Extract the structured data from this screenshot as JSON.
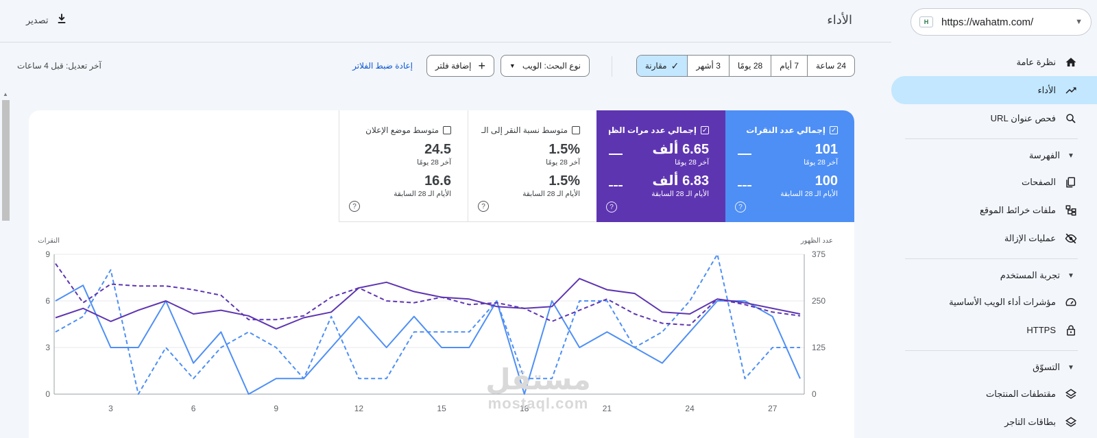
{
  "sidebar": {
    "property_url": "https://wahatm.com/",
    "property_favicon": "H",
    "nav_items": [
      {
        "label": "نظرة عامة",
        "icon": "home-icon"
      },
      {
        "label": "الأداء",
        "icon": "trending-up-icon"
      },
      {
        "label": "فحص عنوان URL",
        "icon": "search-icon"
      }
    ],
    "sections": [
      {
        "label": "الفهرسة",
        "items": [
          {
            "label": "الصفحات",
            "icon": "pages-icon"
          },
          {
            "label": "ملفات خرائط الموقع",
            "icon": "sitemap-icon"
          },
          {
            "label": "عمليات الإزالة",
            "icon": "eye-off-icon"
          }
        ]
      },
      {
        "label": "تجربة المستخدم",
        "items": [
          {
            "label": "مؤشرات أداء الويب الأساسية",
            "icon": "speedometer-icon"
          },
          {
            "label": "HTTPS",
            "icon": "lock-icon"
          }
        ]
      },
      {
        "label": "التسوّق",
        "items": [
          {
            "label": "مقتطفات المنتجات",
            "icon": "layers-icon"
          },
          {
            "label": "بطاقات التاجر",
            "icon": "layers-icon"
          }
        ]
      }
    ]
  },
  "header": {
    "title": "الأداء",
    "export_label": "تصدير"
  },
  "filters": {
    "ranges": [
      "24 ساعة",
      "7 أيام",
      "28 يومًا",
      "3 أشهر"
    ],
    "compare_label": "مقارنة",
    "search_type_label": "نوع البحث: الويب",
    "add_filter_label": "إضافة فلتر",
    "reset_label": "إعادة ضبط الفلاتر",
    "last_updated": "آخر تعديل: قبل 4 ساعات"
  },
  "metrics": [
    {
      "title": "إجمالي عدد النقرات",
      "checked": true,
      "current": "101",
      "current_label": "آخر 28 يومًا",
      "previous": "100",
      "previous_label": "الأيام الـ 28 السابقة",
      "color": "#4e8ff5"
    },
    {
      "title": "إجمالي عدد مرات الظهـ...",
      "checked": true,
      "current": "6.65 ألف",
      "current_label": "آخر 28 يومًا",
      "previous": "6.83 ألف",
      "previous_label": "الأيام الـ 28 السابقة",
      "color": "#5e35b1"
    },
    {
      "title": "متوسط نسبة النقر إلى الـ...",
      "checked": false,
      "current": "1.5%",
      "current_label": "آخر 28 يومًا",
      "previous": "1.5%",
      "previous_label": "الأيام الـ 28 السابقة"
    },
    {
      "title": "متوسط موضع الإعلان",
      "checked": false,
      "current": "24.5",
      "current_label": "آخر 28 يومًا",
      "previous": "16.6",
      "previous_label": "الأيام الـ 28 السابقة"
    }
  ],
  "chart_data": {
    "type": "line",
    "left_axis_label": "النقرات",
    "right_axis_label": "عدد الظهور",
    "left_ylim": [
      0,
      9
    ],
    "left_ticks": [
      0,
      3,
      6,
      9
    ],
    "right_ylim": [
      0,
      375
    ],
    "right_ticks": [
      0,
      125,
      250,
      375
    ],
    "x": [
      1,
      2,
      3,
      4,
      5,
      6,
      7,
      8,
      9,
      10,
      11,
      12,
      13,
      14,
      15,
      16,
      17,
      18,
      19,
      20,
      21,
      22,
      23,
      24,
      25,
      26,
      27,
      28
    ],
    "x_ticks": [
      3,
      6,
      9,
      12,
      15,
      18,
      21,
      24,
      27
    ],
    "grid": true,
    "series": [
      {
        "metric": "clicks",
        "period": "current",
        "axis": "left",
        "style": "solid",
        "color": "#4e8ff5",
        "values": [
          6,
          7,
          3,
          3,
          6,
          2,
          4,
          0,
          1,
          1,
          3,
          5,
          3,
          5,
          3,
          3,
          6,
          0,
          6,
          3,
          4,
          3,
          2,
          4,
          6,
          6,
          5,
          1
        ]
      },
      {
        "metric": "clicks",
        "period": "previous",
        "axis": "left",
        "style": "dashed",
        "color": "#4e8ff5",
        "values": [
          4,
          5,
          8,
          0,
          3,
          1,
          3,
          4,
          3,
          1,
          5,
          1,
          1,
          4,
          4,
          4,
          6,
          1,
          1,
          6,
          6,
          3,
          4,
          6,
          9,
          1,
          3,
          3
        ]
      },
      {
        "metric": "impressions",
        "period": "current",
        "axis": "right",
        "style": "solid",
        "color": "#5e35b1",
        "values": [
          205,
          230,
          195,
          225,
          250,
          215,
          225,
          210,
          175,
          205,
          220,
          285,
          300,
          275,
          260,
          255,
          235,
          230,
          235,
          310,
          280,
          270,
          220,
          215,
          255,
          245,
          230,
          215
        ]
      },
      {
        "metric": "impressions",
        "period": "previous",
        "axis": "right",
        "style": "dashed",
        "color": "#5e35b1",
        "values": [
          350,
          245,
          295,
          290,
          290,
          280,
          265,
          200,
          200,
          210,
          260,
          285,
          250,
          245,
          260,
          240,
          245,
          230,
          195,
          225,
          255,
          215,
          190,
          185,
          255,
          240,
          220,
          210
        ]
      }
    ]
  },
  "watermark": {
    "arabic": "مستقل",
    "latin": "mostaql.com"
  }
}
